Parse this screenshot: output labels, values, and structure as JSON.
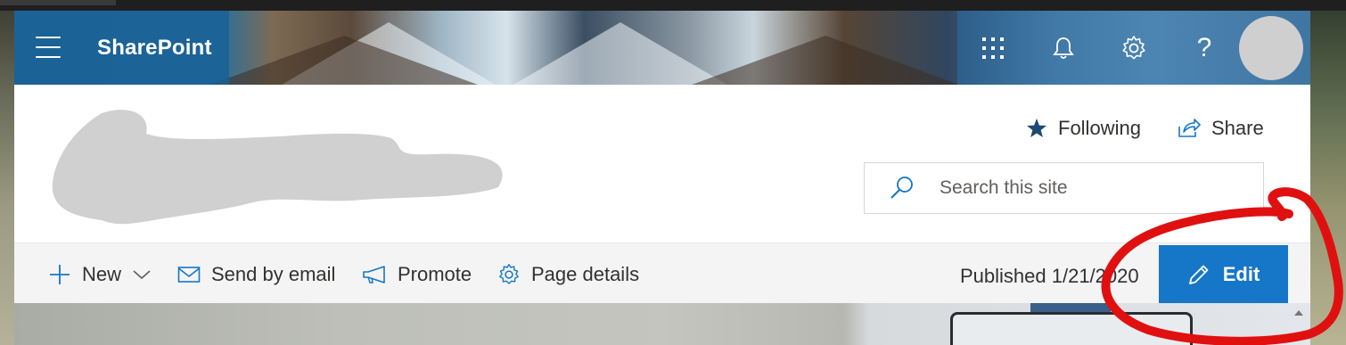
{
  "suite_bar": {
    "brand": "SharePoint",
    "icons": [
      "menu-icon",
      "waffle-icon",
      "bell-icon",
      "gear-icon",
      "help-icon",
      "avatar"
    ],
    "help_label": "?"
  },
  "site_header": {
    "follow_label": "Following",
    "share_label": "Share",
    "search_placeholder": "Search this site"
  },
  "command_bar": {
    "new_label": "New",
    "send_email_label": "Send by email",
    "promote_label": "Promote",
    "page_details_label": "Page details",
    "published_text": "Published 1/21/2020",
    "edit_label": "Edit"
  },
  "colors": {
    "accent": "#1676c8",
    "follow_star": "#1b4a76",
    "annotation": "#e01010"
  }
}
